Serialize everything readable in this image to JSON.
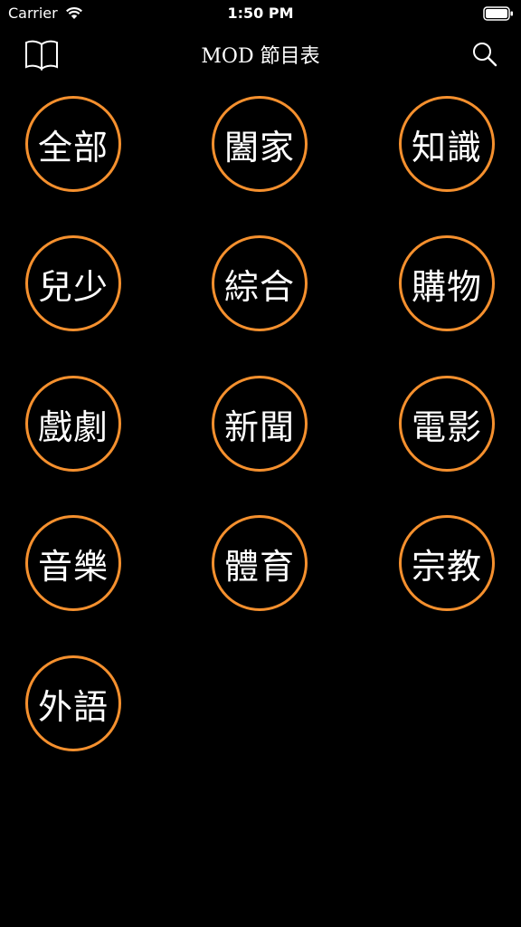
{
  "status_bar": {
    "carrier": "Carrier",
    "time": "1:50 PM"
  },
  "nav": {
    "title": "MOD 節目表",
    "left_icon": "book-icon",
    "right_icon": "search-icon"
  },
  "theme": {
    "background": "#000000",
    "accent": "#f5902e",
    "text": "#ffffff"
  },
  "categories": [
    "全部",
    "闔家",
    "知識",
    "兒少",
    "綜合",
    "購物",
    "戲劇",
    "新聞",
    "電影",
    "音樂",
    "體育",
    "宗教",
    "外語"
  ]
}
